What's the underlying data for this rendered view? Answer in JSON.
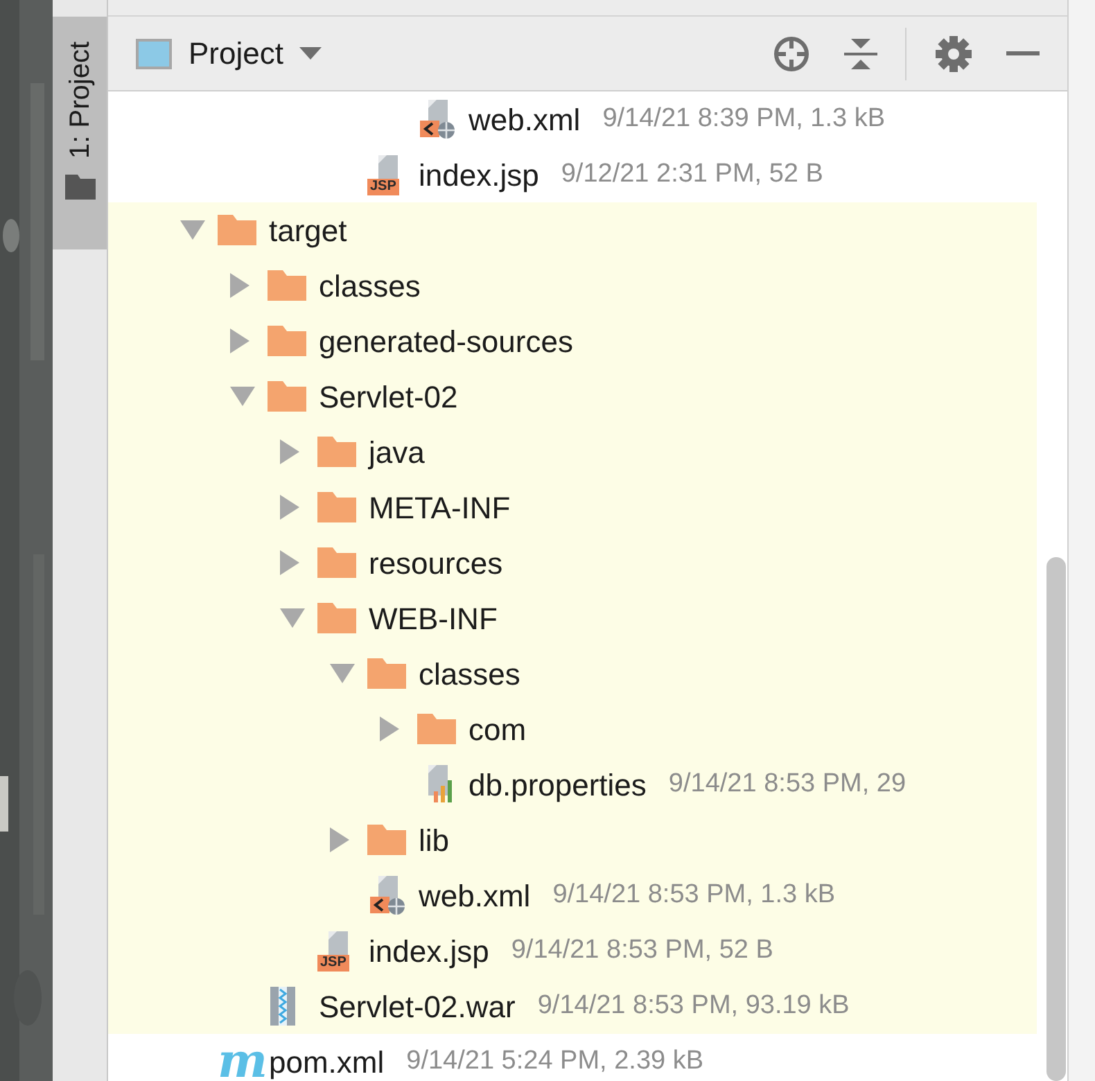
{
  "sidebar": {
    "tabs": [
      {
        "label": "1: Project",
        "selected": true
      }
    ]
  },
  "header": {
    "title": "Project"
  },
  "tree": [
    {
      "children": [
        {
          "children": [
            {
              "children": [
                {
                  "children": [
                    {
                      "kind": "xml",
                      "name": "web.xml",
                      "meta": "9/14/21 8:39 PM, 1.3 kB"
                    }
                  ]
                },
                {
                  "kind": "jsp",
                  "badge": "JSP",
                  "name": "index.jsp",
                  "meta": "9/12/21 2:31 PM, 52 B"
                }
              ]
            }
          ]
        }
      ]
    },
    {
      "kind": "folder",
      "name": "target",
      "expanded": true,
      "excluded": true,
      "children": [
        {
          "kind": "folder",
          "name": "classes",
          "expanded": false
        },
        {
          "kind": "folder",
          "name": "generated-sources",
          "expanded": false
        },
        {
          "kind": "folder",
          "name": "Servlet-02",
          "expanded": true,
          "children": [
            {
              "kind": "folder",
              "name": "java",
              "expanded": false
            },
            {
              "kind": "folder",
              "name": "META-INF",
              "expanded": false
            },
            {
              "kind": "folder",
              "name": "resources",
              "expanded": false
            },
            {
              "kind": "folder",
              "name": "WEB-INF",
              "expanded": true,
              "children": [
                {
                  "kind": "folder",
                  "name": "classes",
                  "expanded": true,
                  "children": [
                    {
                      "kind": "folder",
                      "name": "com",
                      "expanded": false
                    },
                    {
                      "kind": "properties",
                      "name": "db.properties",
                      "meta": "9/14/21 8:53 PM, 29"
                    }
                  ]
                },
                {
                  "kind": "folder",
                  "name": "lib",
                  "expanded": false
                },
                {
                  "kind": "xml",
                  "name": "web.xml",
                  "meta": "9/14/21 8:53 PM, 1.3 kB"
                }
              ]
            },
            {
              "kind": "jsp",
              "badge": "JSP",
              "name": "index.jsp",
              "meta": "9/14/21 8:53 PM, 52 B"
            }
          ]
        },
        {
          "kind": "war",
          "name": "Servlet-02.war",
          "meta": "9/14/21 8:53 PM, 93.19 kB"
        }
      ]
    },
    {
      "kind": "maven",
      "badge": "m",
      "name": "pom.xml",
      "meta": "9/14/21 5:24 PM, 2.39 kB"
    }
  ]
}
